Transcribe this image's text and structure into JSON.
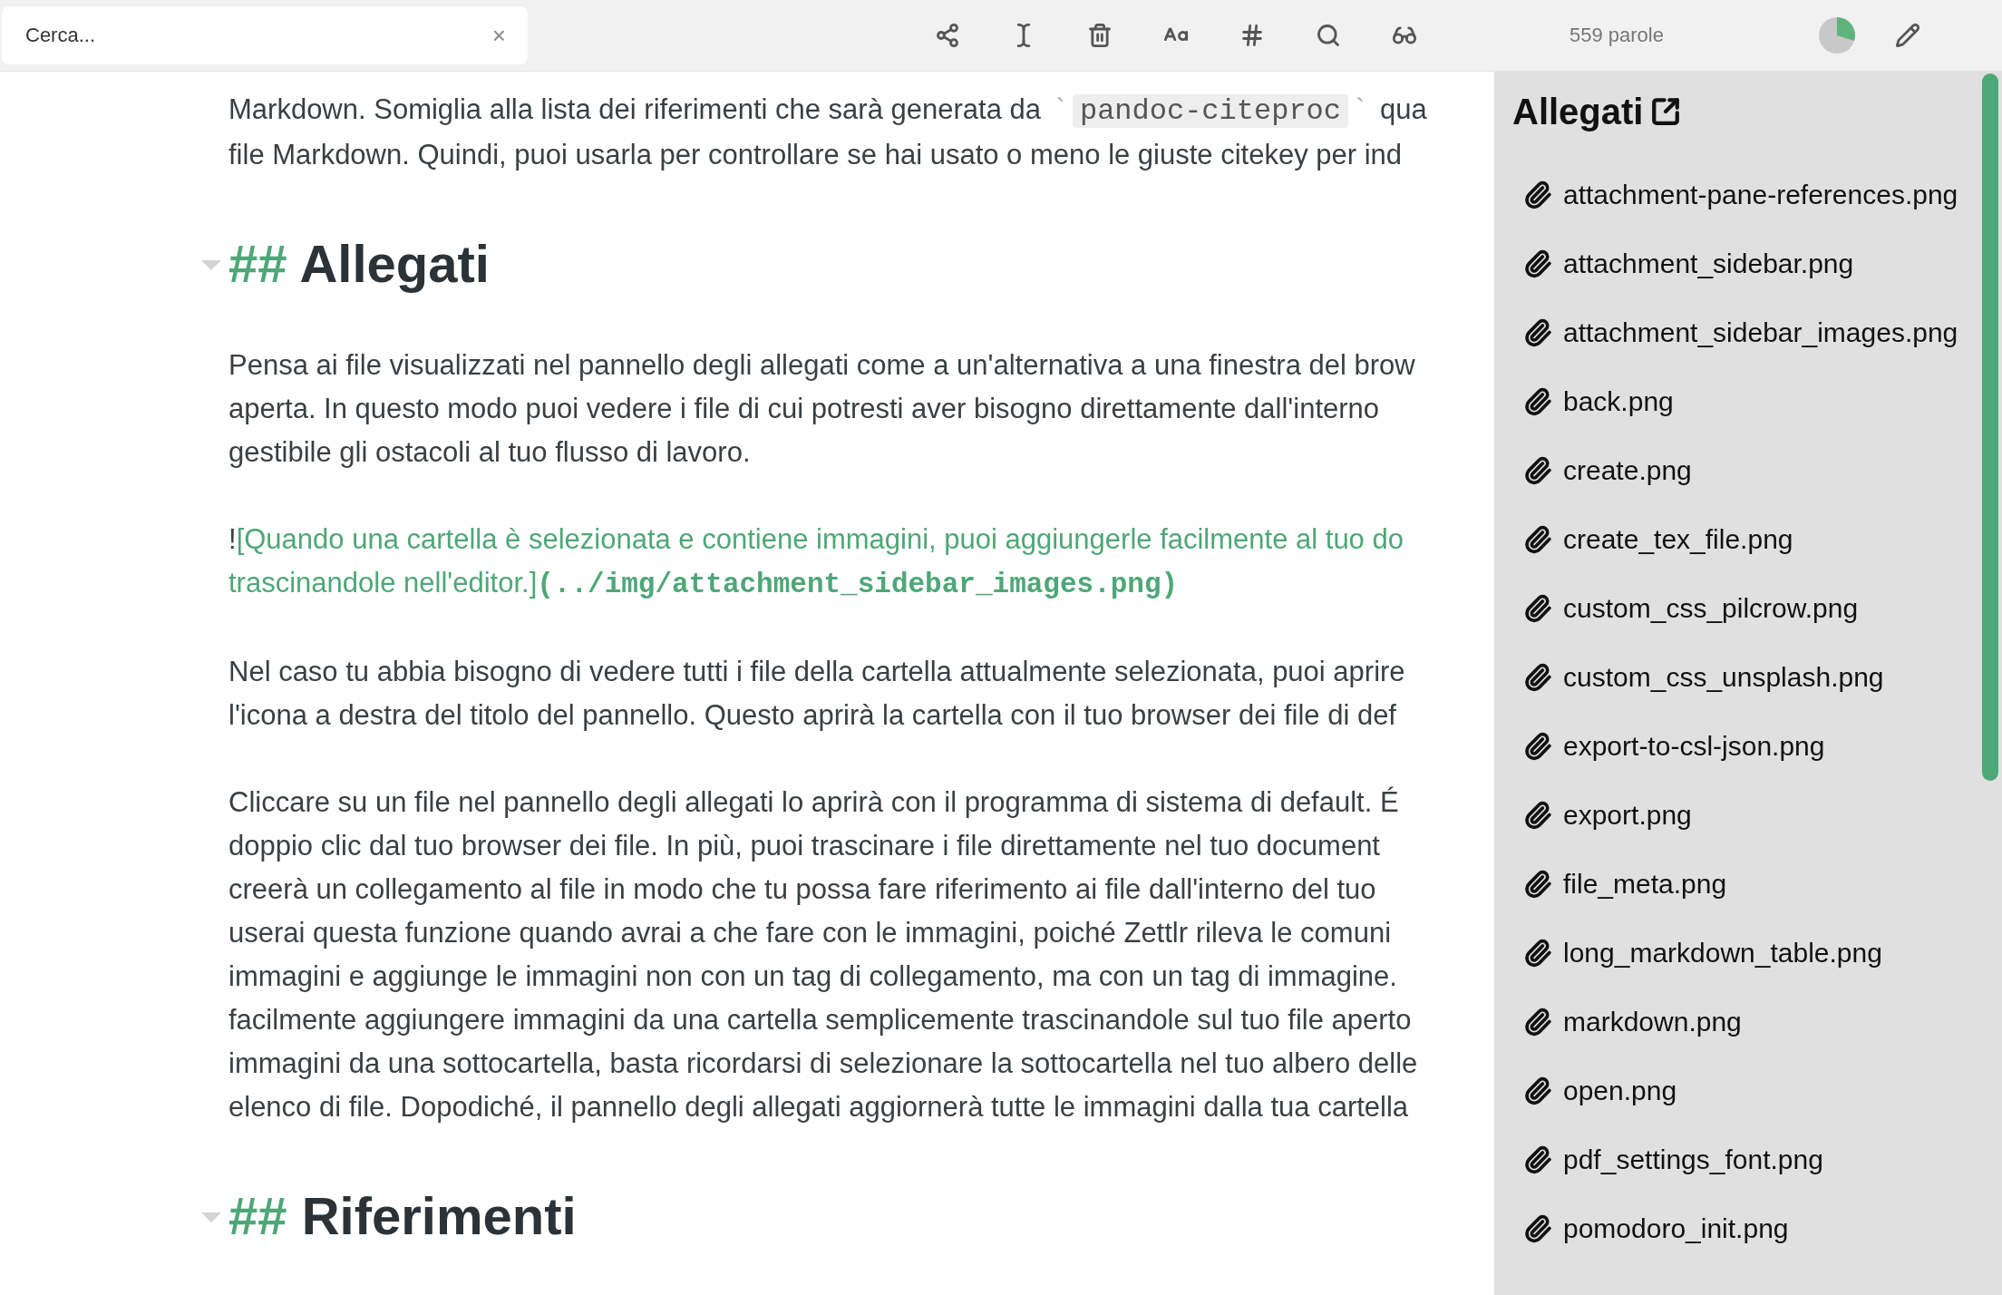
{
  "search": {
    "placeholder": "Cerca...",
    "clear": "×"
  },
  "toolbar": {
    "word_count": "559 parole"
  },
  "editor": {
    "blocks": [
      {
        "kind": "paragraph",
        "lines": [
          [
            {
              "kind": "text",
              "text": "Markdown. Somiglia alla lista dei riferimenti che sarà generata da "
            },
            {
              "kind": "tick",
              "text": "`"
            },
            {
              "kind": "code",
              "text": "pandoc-citeproc"
            },
            {
              "kind": "tick",
              "text": "`"
            },
            {
              "kind": "text",
              "text": " qua"
            }
          ],
          "file Markdown. Quindi, puoi usarla per controllare se hai usato o meno le giuste citekey per ind"
        ]
      },
      {
        "kind": "heading",
        "marker": "##",
        "text": "Allegati"
      },
      {
        "kind": "paragraph",
        "lines": [
          "Pensa ai file visualizzati nel pannello degli allegati come a un'alternativa a una finestra del brow",
          "aperta. In questo modo puoi vedere i file di cui potresti aver bisogno direttamente dall'interno",
          "gestibile gli ostacoli al tuo flusso di lavoro."
        ]
      },
      {
        "kind": "paragraph",
        "lines": [
          [
            {
              "kind": "mark",
              "text": "!"
            },
            {
              "kind": "alt",
              "text": "[Quando una cartella è selezionata e contiene immagini, puoi aggiungerle facilmente al tuo do"
            }
          ],
          [
            {
              "kind": "alt",
              "text": "trascinandole nell'editor.]"
            },
            {
              "kind": "url",
              "text": "(../img/attachment_sidebar_images.png)"
            }
          ]
        ]
      },
      {
        "kind": "paragraph",
        "lines": [
          "Nel caso tu abbia bisogno di vedere tutti i file della cartella attualmente selezionata, puoi aprire",
          "l'icona a destra del titolo del pannello. Questo aprirà la cartella con il tuo browser dei file di def"
        ]
      },
      {
        "kind": "paragraph",
        "lines": [
          "Cliccare su un file nel pannello degli allegati lo aprirà con il programma di sistema di default. É",
          "doppio clic dal tuo browser dei file. In più, puoi trascinare i file direttamente nel tuo document",
          "creerà un collegamento al file in modo che tu possa fare riferimento ai file dall'interno del tuo",
          "userai questa funzione quando avrai a che fare con le immagini, poiché Zettlr rileva le comuni",
          "immagini e aggiunge le immagini non con un tag di collegamento, ma con un tag di immagine.",
          "facilmente aggiungere immagini da una cartella semplicemente trascinandole sul tuo file aperto",
          "immagini da una sottocartella, basta ricordarsi di selezionare la sottocartella nel tuo albero delle",
          "elenco di file. Dopodiché, il pannello degli allegati aggiornerà tutte le immagini dalla tua cartella"
        ]
      },
      {
        "kind": "heading",
        "marker": "##",
        "text": "Riferimenti"
      }
    ]
  },
  "sidebar": {
    "title": "Allegati",
    "files": [
      "attachment-pane-references.png",
      "attachment_sidebar.png",
      "attachment_sidebar_images.png",
      "back.png",
      "create.png",
      "create_tex_file.png",
      "custom_css_pilcrow.png",
      "custom_css_unsplash.png",
      "export-to-csl-json.png",
      "export.png",
      "file_meta.png",
      "long_markdown_table.png",
      "markdown.png",
      "open.png",
      "pdf_settings_font.png",
      "pomodoro_init.png"
    ]
  }
}
